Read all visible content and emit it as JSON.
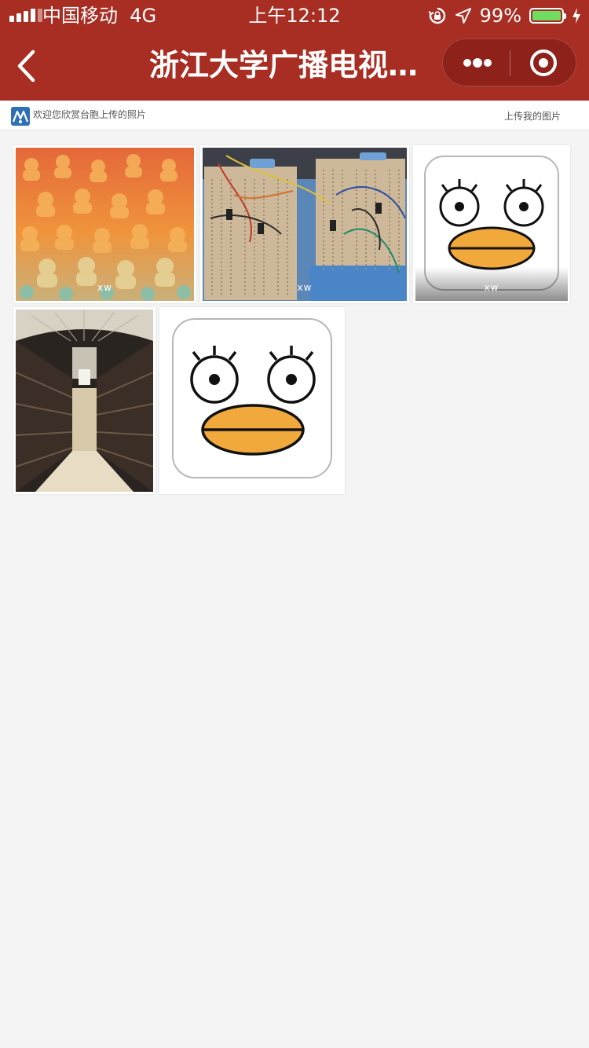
{
  "status_bar": {
    "carrier": "中国移动",
    "network": "4G",
    "time": "上午12:12",
    "battery_percent": "99%",
    "battery_level": 0.99,
    "icons": [
      "signal-icon",
      "orientation-lock-icon",
      "location-arrow-icon",
      "battery-icon",
      "charging-bolt-icon"
    ]
  },
  "nav": {
    "title": "浙江大学广播电视…",
    "back_icon": "chevron-left-icon",
    "more_icon": "more-dots-icon",
    "close_icon": "circle-target-icon"
  },
  "header": {
    "welcome_text": "欢迎您欣赏台胞上传的照片",
    "upload_link": "上传我的图片",
    "logo_icon": "station-logo-icon"
  },
  "photos": [
    {
      "caption": "xw",
      "subject": "orange-silhouettes-painting"
    },
    {
      "caption": "xw",
      "subject": "electronics-breadboards"
    },
    {
      "caption": "xw",
      "subject": "duck-face-app-icon"
    },
    {
      "caption": "",
      "subject": "library-hall-bookshelves"
    },
    {
      "caption": "",
      "subject": "duck-face-app-icon"
    }
  ],
  "colors": {
    "nav_bar": "#a82e24",
    "capsule": "#8e2119",
    "page_background": "#f4f4f4",
    "battery_fill": "#6fdc62",
    "duck_beak": "#f2a93b"
  }
}
